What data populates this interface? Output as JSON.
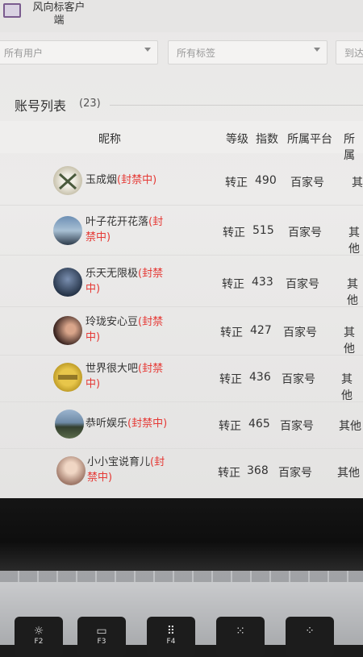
{
  "app": {
    "title": "风向标客户端"
  },
  "filters": [
    {
      "label": "所有用户"
    },
    {
      "label": "所有标签"
    },
    {
      "label": "到达"
    }
  ],
  "section": {
    "title": "账号列表",
    "count": "(23)"
  },
  "table": {
    "headers": {
      "name": "昵称",
      "level": "等级",
      "index": "指数",
      "platform": "所属平台",
      "category": "所属"
    },
    "rows": [
      {
        "name": "玉成烟",
        "ban": "(封禁中)",
        "level": "转正",
        "index": "490",
        "platform": "百家号",
        "category": "其"
      },
      {
        "name": "叶子花开花落",
        "ban": "(封禁中)",
        "level": "转正",
        "index": "515",
        "platform": "百家号",
        "category": "其他"
      },
      {
        "name": "乐天无限极",
        "ban": "(封禁中)",
        "level": "转正",
        "index": "433",
        "platform": "百家号",
        "category": "其他"
      },
      {
        "name": "玲珑安心豆",
        "ban": "(封禁中)",
        "level": "转正",
        "index": "427",
        "platform": "百家号",
        "category": "其他"
      },
      {
        "name": "世界很大吧",
        "ban": "(封禁中)",
        "level": "转正",
        "index": "436",
        "platform": "百家号",
        "category": "其他"
      },
      {
        "name": "恭听娱乐",
        "ban": "(封禁中)",
        "level": "转正",
        "index": "465",
        "platform": "百家号",
        "category": "其他"
      },
      {
        "name": "小小宝说育儿",
        "ban": "(封禁中)",
        "level": "转正",
        "index": "368",
        "platform": "百家号",
        "category": "其他"
      }
    ]
  },
  "keyboard": {
    "keys": [
      {
        "icon": "brightness-icon",
        "glyph": "☼",
        "label": "F2"
      },
      {
        "icon": "mission-control-icon",
        "glyph": "▭",
        "label": "F3"
      },
      {
        "icon": "launchpad-icon",
        "glyph": "⠿",
        "label": "F4"
      },
      {
        "icon": "keyboard-light-icon",
        "glyph": "⁙",
        "label": ""
      },
      {
        "icon": "keyboard-light-up-icon",
        "glyph": "⁘",
        "label": ""
      }
    ]
  },
  "colors": {
    "ban_red": "#e53935",
    "text": "#333333"
  }
}
